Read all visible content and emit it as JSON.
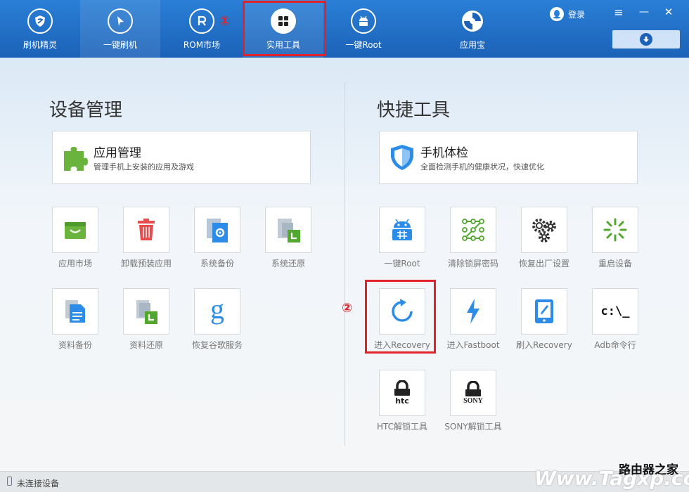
{
  "nav": {
    "items": [
      {
        "label": "刷机精灵",
        "icon": "shield-icon"
      },
      {
        "label": "一键刷机",
        "icon": "cursor-icon"
      },
      {
        "label": "ROM市场",
        "icon": "rom-icon"
      },
      {
        "label": "实用工具",
        "icon": "grid-icon"
      },
      {
        "label": "一键Root",
        "icon": "android-icon"
      },
      {
        "label": "应用宝",
        "icon": "yingyongbao-icon"
      }
    ],
    "active_index": 3
  },
  "markers": {
    "one": "①",
    "two": "②"
  },
  "titlebar": {
    "login_label": "登录",
    "menu": "≡",
    "minimize": "—",
    "close": "✕"
  },
  "device_management": {
    "title": "设备管理",
    "feature": {
      "title": "应用管理",
      "subtitle": "管理手机上安装的应用及游戏"
    },
    "tools": [
      {
        "label": "应用市场",
        "icon": "shopping-bag-icon"
      },
      {
        "label": "卸载预装应用",
        "icon": "trash-icon"
      },
      {
        "label": "系统备份",
        "icon": "system-backup-icon"
      },
      {
        "label": "系统还原",
        "icon": "system-restore-icon"
      },
      {
        "label": "资料备份",
        "icon": "document-backup-icon"
      },
      {
        "label": "资料还原",
        "icon": "document-restore-icon"
      },
      {
        "label": "恢复谷歌服务",
        "icon": "google-icon"
      }
    ]
  },
  "quick_tools": {
    "title": "快捷工具",
    "feature": {
      "title": "手机体检",
      "subtitle": "全面检测手机的健康状况，快速优化"
    },
    "tools": [
      {
        "label": "一键Root",
        "icon": "android-root-icon"
      },
      {
        "label": "清除锁屏密码",
        "icon": "pattern-lock-icon"
      },
      {
        "label": "恢复出厂设置",
        "icon": "gears-icon"
      },
      {
        "label": "重启设备",
        "icon": "restart-spinner-icon"
      },
      {
        "label": "进入Recovery",
        "icon": "refresh-arrow-icon"
      },
      {
        "label": "进入Fastboot",
        "icon": "lightning-icon"
      },
      {
        "label": "刷入Recovery",
        "icon": "tablet-edit-icon"
      },
      {
        "label": "Adb命令行",
        "icon": "terminal-icon",
        "glyph": "c:\\_"
      },
      {
        "label": "HTC解锁工具",
        "icon": "htc-lock-icon",
        "brand": "htc"
      },
      {
        "label": "SONY解锁工具",
        "icon": "sony-lock-icon",
        "brand": "SONY"
      }
    ]
  },
  "status": {
    "text": "未连接设备"
  },
  "watermark": {
    "top": "路由器之家",
    "main": "Www.Tagxp.com"
  },
  "colors": {
    "nav_blue": "#1b62b8",
    "highlight_red": "#e0232a",
    "accent_blue": "#2d8ce8"
  }
}
